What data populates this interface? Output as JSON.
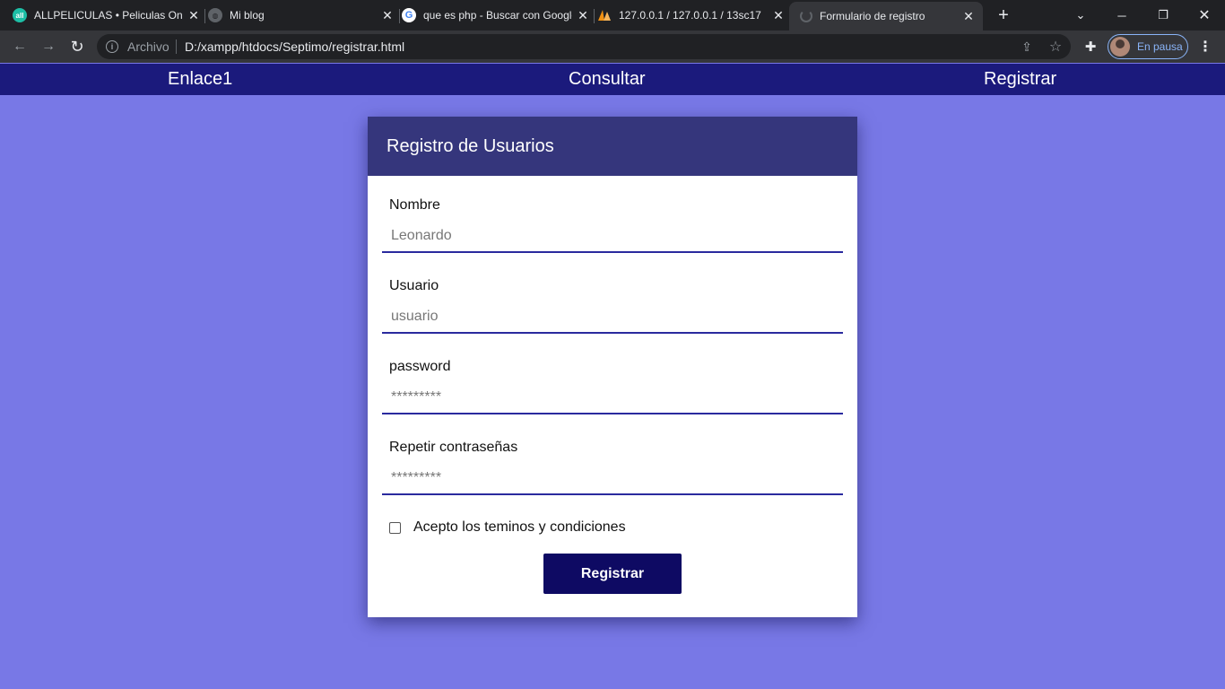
{
  "browser": {
    "tabs": [
      {
        "title": "ALLPELICULAS • Peliculas Online",
        "icon": "allpeliculas-favicon-icon",
        "favicon_text": "all"
      },
      {
        "title": "Mi blog",
        "icon": "globe-icon"
      },
      {
        "title": "que es php - Buscar con Google",
        "icon": "google-g-icon"
      },
      {
        "title": "127.0.0.1 / 127.0.0.1 / 13sc17",
        "icon": "phpmyadmin-icon"
      },
      {
        "title": "Formulario de registro",
        "icon": "loading-spinner-icon",
        "active": true
      }
    ],
    "address_bar": {
      "scheme_label": "Archivo",
      "url": "D:/xampp/htdocs/Septimo/registrar.html"
    },
    "profile_label": "En pausa"
  },
  "site_nav": {
    "links": [
      "Enlace1",
      "Consultar",
      "Registrar"
    ]
  },
  "form": {
    "title": "Registro de Usuarios",
    "fields": [
      {
        "label": "Nombre",
        "placeholder": "Leonardo"
      },
      {
        "label": "Usuario",
        "placeholder": "usuario"
      },
      {
        "label": "password",
        "placeholder": "*********"
      },
      {
        "label": "Repetir contraseñas",
        "placeholder": "*********"
      }
    ],
    "terms_label": "Acepto los teminos y condiciones",
    "terms_checked": false,
    "submit_label": "Registrar"
  },
  "colors": {
    "page_background": "#7878e6",
    "nav_background": "#1b1a7c",
    "card_header": "#35367c",
    "input_underline": "#2a2a9e",
    "button_background": "#0e0a63"
  }
}
